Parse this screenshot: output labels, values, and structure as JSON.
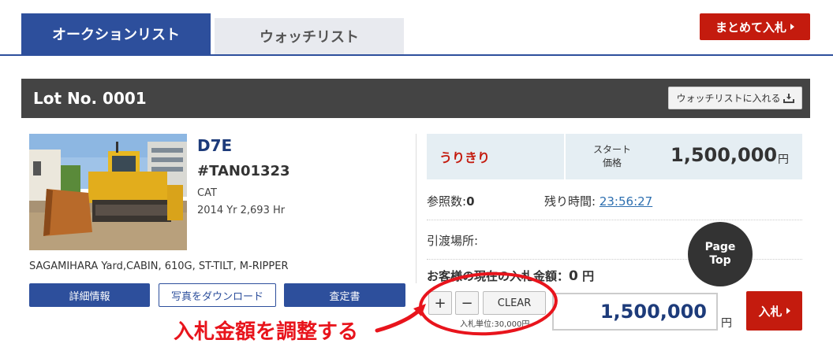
{
  "tabs": {
    "auction_list": "オークションリスト",
    "watch_list": "ウォッチリスト"
  },
  "bulk_bid_label": "まとめて入札",
  "lot": {
    "title": "Lot No. 0001",
    "watch_add_label": "ウォッチリストに入れる",
    "model": "D7E",
    "serial": "#TAN01323",
    "maker": "CAT",
    "year_hours": "2014 Yr 2,693 Hr",
    "description": "SAGAMIHARA Yard,CABIN, 610G, ST-TILT, M-RIPPER",
    "buttons": {
      "details": "詳細情報",
      "download_photos": "写真をダウンロード",
      "inspection": "査定書"
    }
  },
  "price": {
    "sale_type": "うりきり",
    "start_label_line1": "スタート",
    "start_label_line2": "価格",
    "start_price": "1,500,000",
    "currency": "円"
  },
  "info": {
    "ref_label": "参照数:",
    "ref_value": "0",
    "time_label": "残り時間:",
    "time_value": "23:56:27",
    "place_label": "引渡場所:",
    "current_bid_label": "お客様の現在の入札金額：",
    "current_bid_value": "0",
    "current_bid_currency": "円"
  },
  "bid": {
    "plus": "+",
    "minus": "−",
    "clear": "CLEAR",
    "unit_note": "入札単位:30,000円",
    "amount": "1,500,000",
    "currency": "円",
    "submit": "入札"
  },
  "page_top": {
    "line1": "Page",
    "line2": "Top"
  },
  "annotation": "入札金額を調整する",
  "colors": {
    "brand_blue": "#2d4f9c",
    "accent_red": "#c41b0e",
    "annotation_red": "#e8141c"
  }
}
